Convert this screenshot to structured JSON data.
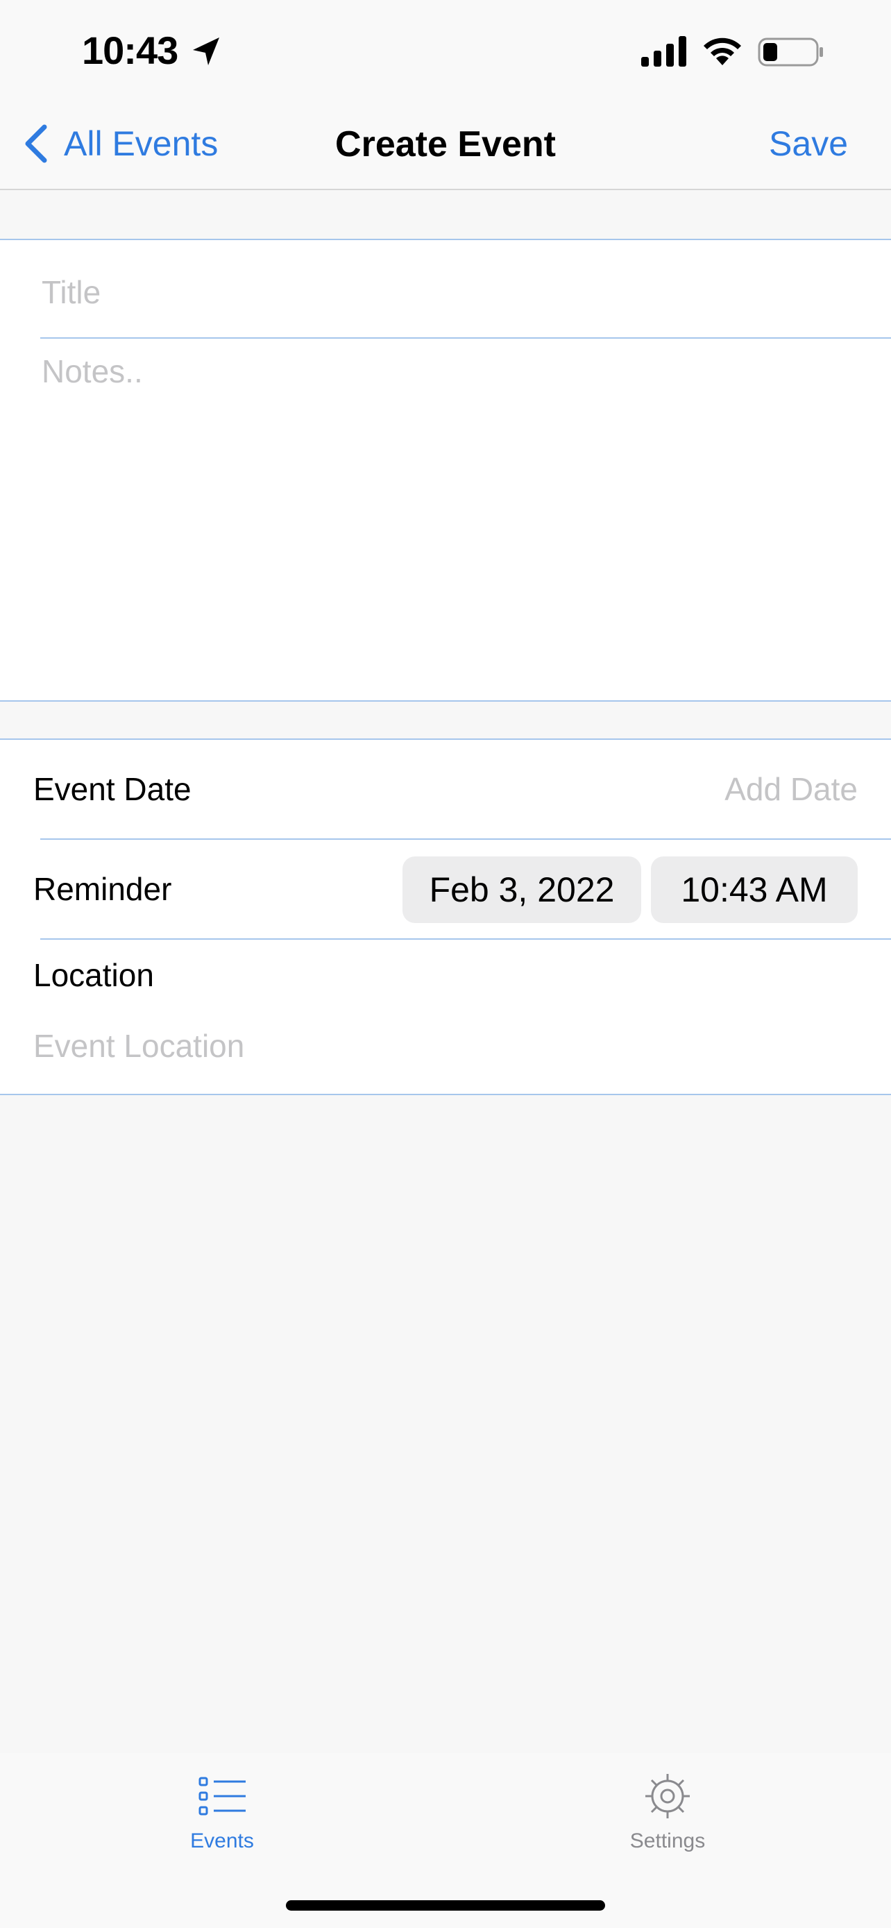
{
  "status_bar": {
    "time": "10:43",
    "icons": [
      "location-arrow-icon",
      "cellular-signal-icon",
      "wifi-icon",
      "battery-icon"
    ]
  },
  "nav": {
    "back_label": "All Events",
    "title": "Create Event",
    "save_label": "Save"
  },
  "form": {
    "title_placeholder": "Title",
    "title_value": "",
    "notes_placeholder": "Notes..",
    "notes_value": "",
    "event_date_label": "Event Date",
    "event_date_placeholder": "Add Date",
    "reminder_label": "Reminder",
    "reminder_date": "Feb 3, 2022",
    "reminder_time": "10:43 AM",
    "location_label": "Location",
    "location_placeholder": "Event Location",
    "location_value": ""
  },
  "tab_bar": {
    "items": [
      {
        "label": "Events",
        "icon": "list-icon",
        "selected": true
      },
      {
        "label": "Settings",
        "icon": "gear-icon",
        "selected": false
      }
    ]
  },
  "colors": {
    "accent": "#2f7be0",
    "separator": "#a6c6ec",
    "placeholder": "#c4c4c6",
    "background": "#f7f7f7",
    "chip": "#ececed"
  }
}
